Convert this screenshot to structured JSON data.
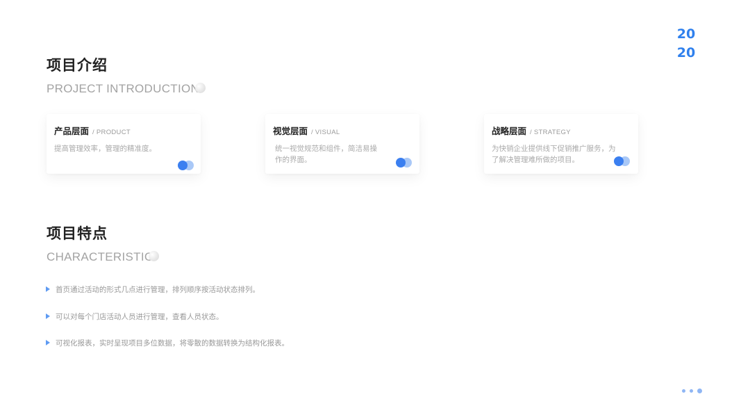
{
  "year": {
    "line1": "20",
    "line2": "20"
  },
  "intro": {
    "title": "项目介绍",
    "subtitle": "PROJECT INTRODUCTION",
    "cards": [
      {
        "title": "产品层面",
        "en": "/ PRODUCT",
        "desc": "提高管理效率，管理的精准度。"
      },
      {
        "title": "视觉层面",
        "en": "/ VISUAL",
        "desc": "统一视觉规范和组件，简洁易操作的界面。"
      },
      {
        "title": "战略层面",
        "en": "/ STRATEGY",
        "desc": "为快销企业提供线下促销推广服务，为了解决管理难所做的项目。"
      }
    ]
  },
  "characteristic": {
    "title": "项目特点",
    "subtitle": "CHARACTERISTIC",
    "items": [
      "首页通过活动的形式几点进行管理，排列顺序按活动状态排列。",
      "可以对每个门店活动人员进行管理，查看人员状态。",
      "可视化报表，实时呈现项目多位数据，将零散的数据转换为结构化报表。"
    ]
  },
  "colors": {
    "accent": "#2f80ed",
    "accent_light": "#a9c8f7",
    "subtitle_gray": "#a3a3a3"
  }
}
